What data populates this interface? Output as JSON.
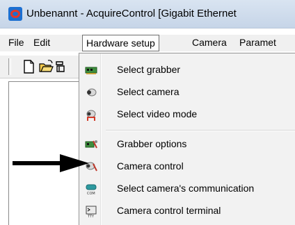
{
  "window": {
    "title": "Unbenannt - AcquireControl [Gigabit Ethernet"
  },
  "menubar": {
    "items": [
      "File",
      "Edit",
      "Hardware setup",
      "Camera",
      "Paramet"
    ],
    "active": "Hardware setup"
  },
  "dropdown": {
    "items": [
      {
        "label": "Select grabber",
        "icon": "grabber-card-icon"
      },
      {
        "label": "Select camera",
        "icon": "camera-icon"
      },
      {
        "label": "Select video mode",
        "icon": "video-mode-icon"
      },
      {
        "label": "Grabber options",
        "icon": "grabber-options-icon"
      },
      {
        "label": "Camera control",
        "icon": "camera-control-icon"
      },
      {
        "label": "Select camera's communication",
        "icon": "com-port-icon"
      },
      {
        "label": "Camera control terminal",
        "icon": "terminal-icon"
      }
    ]
  },
  "colors": {
    "accent": "#1c6fd1",
    "arrow": "#000000"
  }
}
